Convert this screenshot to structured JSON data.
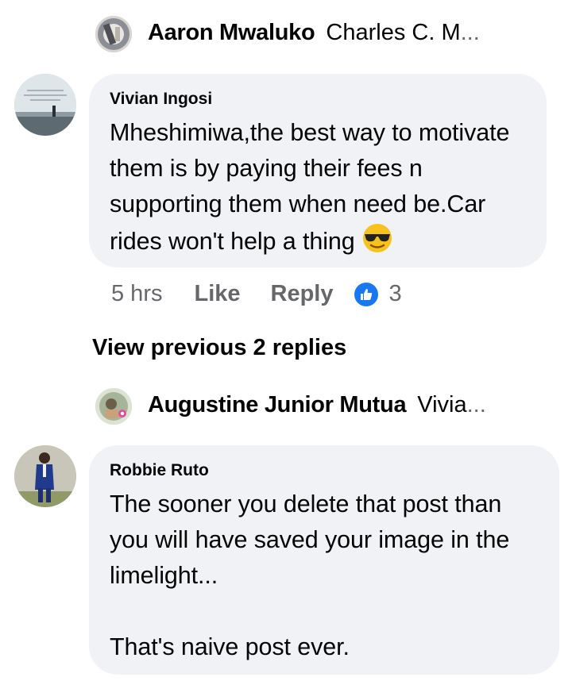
{
  "reply_1": {
    "author": "Aaron Mwaluko",
    "snippet": "Charles C. M",
    "ellipsis": "...",
    "avatar_icon": "user-avatar"
  },
  "comment_1": {
    "author": "Vivian Ingosi",
    "text": "Mheshimiwa,the best way to motivate them is by paying their fees n supporting them when need be.Car rides won't help a thing",
    "emoji_icon": "smiling-face-with-sunglasses",
    "avatar_icon": "user-avatar",
    "time": "5 hrs",
    "like_label": "Like",
    "reply_label": "Reply",
    "reaction_count": "3",
    "reaction_icon": "thumbs-up-icon"
  },
  "view_previous": "View previous 2 replies",
  "reply_2": {
    "author": "Augustine Junior Mutua",
    "snippet": "Vivia",
    "ellipsis": "...",
    "avatar_icon": "user-avatar"
  },
  "comment_2": {
    "author": "Robbie Ruto",
    "text": "The sooner you delete that post than you will have saved your image in the limelight...\n\nThat's naive post ever.",
    "avatar_icon": "user-avatar"
  },
  "colors": {
    "bubble": "#f0f2f5",
    "meta_text": "#65676b",
    "like_blue": "#1877f2",
    "text": "#050505"
  }
}
